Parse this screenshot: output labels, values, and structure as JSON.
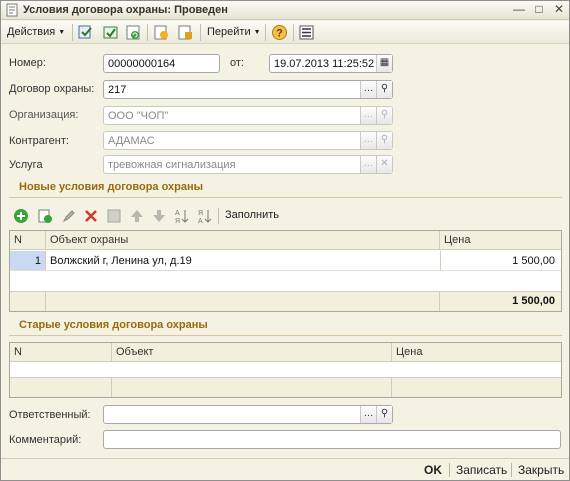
{
  "window": {
    "title": "Условия договора охраны: Проведен",
    "controls": [
      "minimize-icon",
      "maximize-icon",
      "close-icon"
    ]
  },
  "toolbar": {
    "actions_label": "Действия",
    "goto_label": "Перейти",
    "icons": [
      "post-and-close-icon",
      "post-icon",
      "refresh-icon",
      "create-based-on-icon",
      "document-movements-icon",
      "help-icon",
      "structure-icon"
    ]
  },
  "form": {
    "number_label": "Номер:",
    "number_value": "00000000164",
    "date_label": "от:",
    "date_value": "19.07.2013 11:25:52",
    "contract_label": "Договор охраны:",
    "contract_value": "217",
    "organization_label": "Организация:",
    "organization_value": "ООО \"ЧОП\"",
    "counterparty_label": "Контрагент:",
    "counterparty_value": "АДАМАС",
    "service_label": "Услуга",
    "service_value": "тревожная сигнализация"
  },
  "new_conditions": {
    "title": "Новые условия договора охраны",
    "fill_label": "Заполнить",
    "columns": [
      "N",
      "Объект охраны",
      "Цена"
    ],
    "rows": [
      {
        "n": "1",
        "object": "Волжский г, Ленина ул, д.19",
        "price": "1 500,00"
      }
    ],
    "total": "1 500,00"
  },
  "old_conditions": {
    "title": "Старые условия договора охраны",
    "columns": [
      "N",
      "Объект",
      "Цена"
    ]
  },
  "footer_fields": {
    "responsible_label": "Ответственный:",
    "responsible_value": "",
    "comment_label": "Комментарий:",
    "comment_value": ""
  },
  "buttons": {
    "ok": "OK",
    "save": "Записать",
    "close": "Закрыть"
  },
  "colors": {
    "section_title": "#9b6a0b",
    "window_bg": "#f3f2e3",
    "selected_row": "#fff",
    "add_icon": "#3aa33a",
    "delete_icon": "#d23a2a"
  }
}
